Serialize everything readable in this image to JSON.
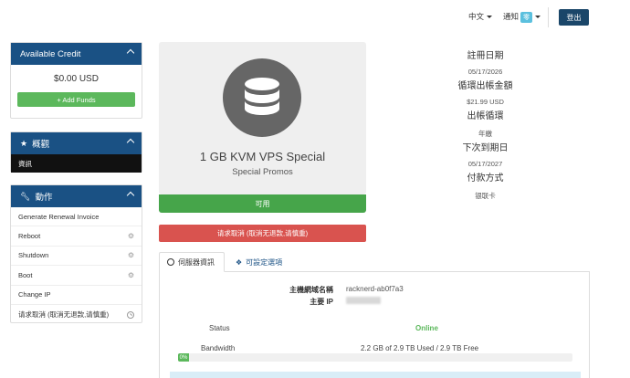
{
  "header": {
    "language": "中文",
    "notifications_label": "通知",
    "notifications_badge": "零",
    "logout_label": "登出"
  },
  "sidebar": {
    "credit": {
      "title": "Available Credit",
      "amount": "$0.00 USD",
      "add_funds": "+ Add Funds"
    },
    "overview": {
      "title": "概觀",
      "items": [
        "資訊"
      ]
    },
    "actions": {
      "title": "動作",
      "items": [
        "Generate Renewal Invoice",
        "Reboot",
        "Shutdown",
        "Boot",
        "Change IP",
        "请求取消 (取消无退款,请慎重)"
      ]
    }
  },
  "product": {
    "name": "1 GB KVM VPS Special",
    "group": "Special Promos",
    "status": "可用",
    "cancel_label": "请求取消 (取消无退款,请慎重)"
  },
  "info": {
    "reg_date_label": "註冊日期",
    "reg_date": "05/17/2026",
    "recurring_label": "循環出帳金額",
    "recurring": "$21.99 USD",
    "cycle_label": "出帳循環",
    "cycle": "年繳",
    "due_label": "下次到期日",
    "due": "05/17/2027",
    "payment_label": "付款方式",
    "payment": "银联卡"
  },
  "tabs": {
    "server_info": "伺服器資訊",
    "config_options": "可設定選項"
  },
  "server": {
    "hostname_label": "主機網域名稱",
    "hostname": "racknerd-ab0f7a3",
    "ip_label": "主要 IP",
    "status_label": "Status",
    "status": "Online",
    "bandwidth_label": "Bandwidth",
    "bandwidth": "2.2 GB of 2.9 TB Used / 2.9 TB Free",
    "bandwidth_percent": "0%"
  },
  "colors": {
    "primary": "#1a5184",
    "success": "#46a54a",
    "danger": "#d9534f",
    "info": "#5bc0de"
  }
}
